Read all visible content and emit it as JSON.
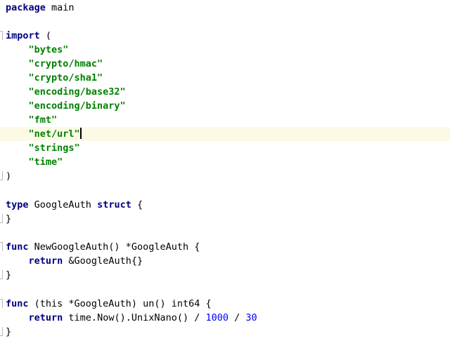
{
  "lines": [
    {
      "text": "package main"
    },
    {
      "text": ""
    },
    {
      "kw": "import",
      "rest": " ("
    },
    {
      "indent": "    ",
      "str": "\"bytes\""
    },
    {
      "indent": "    ",
      "str": "\"crypto/hmac\""
    },
    {
      "indent": "    ",
      "str": "\"crypto/sha1\""
    },
    {
      "indent": "    ",
      "str": "\"encoding/base32\""
    },
    {
      "indent": "    ",
      "str": "\"encoding/binary\""
    },
    {
      "indent": "    ",
      "str": "\"fmt\""
    },
    {
      "indent": "    ",
      "str": "\"net/url\""
    },
    {
      "indent": "    ",
      "str": "\"strings\""
    },
    {
      "indent": "    ",
      "str": "\"time\""
    },
    {
      "text": ")"
    },
    {
      "text": ""
    },
    {
      "kw": "type",
      "mid": " GoogleAuth ",
      "kw2": "struct",
      "rest": " {"
    },
    {
      "text": "}"
    },
    {
      "text": ""
    },
    {
      "kw": "func",
      "rest": " NewGoogleAuth() *GoogleAuth {"
    },
    {
      "indent": "    ",
      "kw": "return",
      "rest": " &GoogleAuth{}"
    },
    {
      "text": "}"
    },
    {
      "text": ""
    },
    {
      "kw": "func",
      "rest": " (this *GoogleAuth) un() int64 {"
    },
    {
      "indent": "    ",
      "kw": "return",
      "mid": " time.Now().UnixNano() / ",
      "num1": "1000",
      "op": " / ",
      "num2": "30"
    },
    {
      "text": "}"
    }
  ],
  "package_line": {
    "kw": "package",
    "rest": " main"
  },
  "current_line_index": 9,
  "colors": {
    "keyword": "#000080",
    "string": "#008000",
    "number": "#0000ff",
    "current_line_bg": "#fcfae4"
  }
}
